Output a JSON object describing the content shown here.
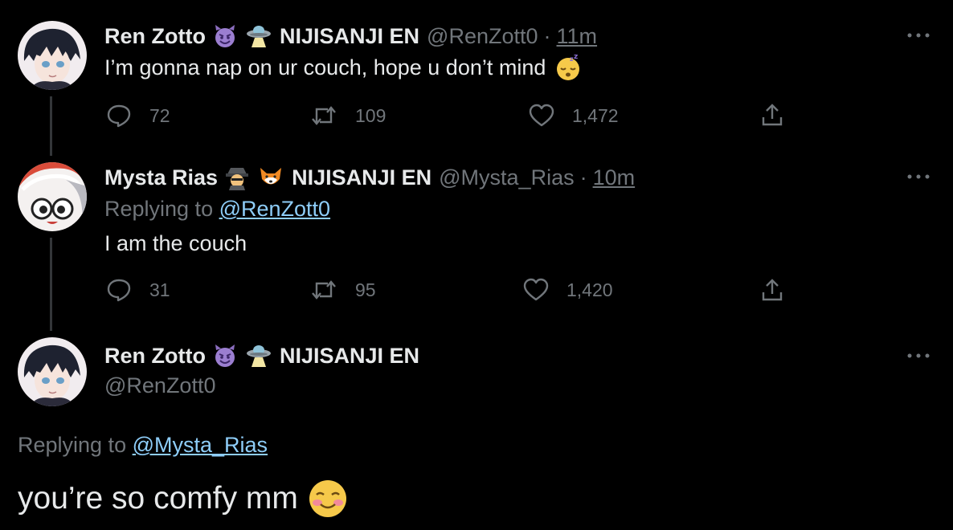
{
  "tweets": [
    {
      "display_name": "Ren Zotto",
      "emojis": [
        "smiling-devil-emoji",
        "ufo-emoji"
      ],
      "affiliation": "NIJISANJI EN",
      "handle": "@RenZott0",
      "separator": "·",
      "time": "11m",
      "text": "I’m gonna nap on ur couch, hope u don’t mind",
      "text_emoji": "sleeping-face-emoji",
      "replies": "72",
      "retweets": "109",
      "likes": "1,472"
    },
    {
      "display_name": "Mysta Rias",
      "emojis": [
        "detective-emoji",
        "fox-emoji"
      ],
      "affiliation": "NIJISANJI EN",
      "handle": "@Mysta_Rias",
      "separator": "·",
      "time": "10m",
      "replying_prefix": "Replying to",
      "replying_to": "@RenZott0",
      "text": "I am the couch",
      "replies": "31",
      "retweets": "95",
      "likes": "1,420"
    }
  ],
  "main_tweet": {
    "display_name": "Ren Zotto",
    "emojis": [
      "smiling-devil-emoji",
      "ufo-emoji"
    ],
    "affiliation": "NIJISANJI EN",
    "handle": "@RenZott0",
    "replying_prefix": "Replying to",
    "replying_to": "@Mysta_Rias",
    "text": "you’re so comfy mm",
    "text_emoji": "smiling-face-emoji"
  },
  "colors": {
    "background": "#000000",
    "primary_text": "#e7e9ea",
    "secondary_text": "#71767b",
    "link": "#8ecdf8",
    "thread_line": "#333639"
  }
}
